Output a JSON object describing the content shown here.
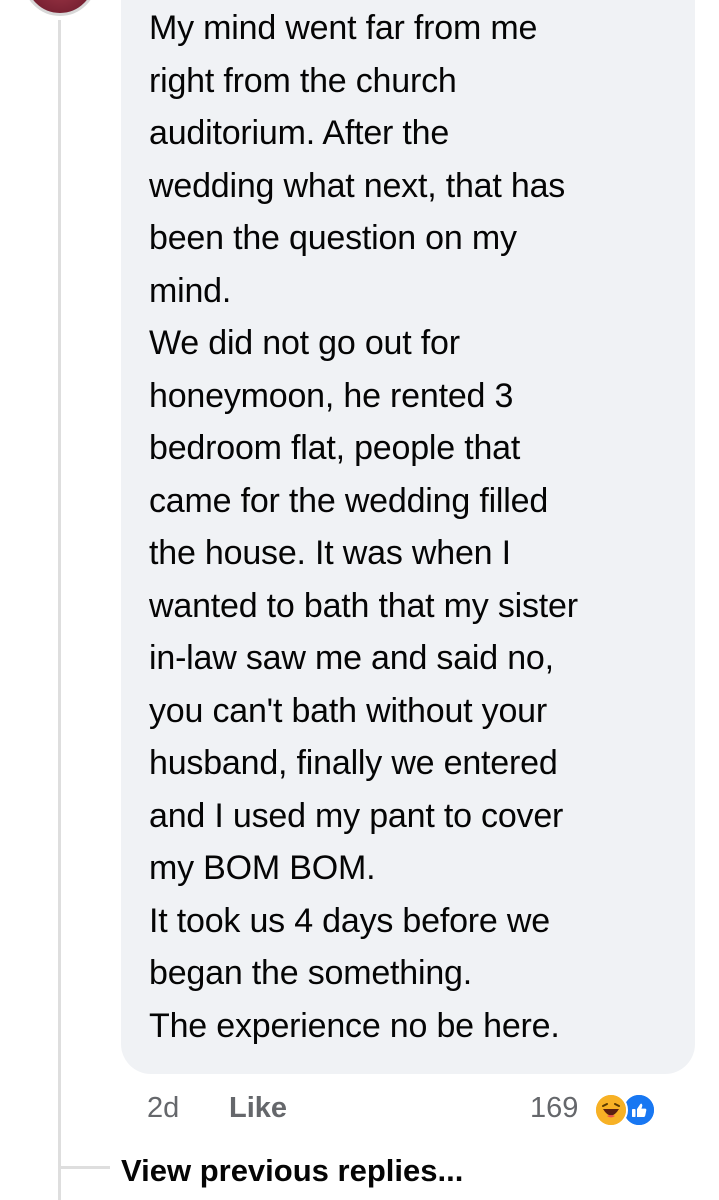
{
  "comment": {
    "text": "My mind went far from me\nright from the church\nauditorium. After the\nwedding what next, that has\nbeen the question on my\nmind.\nWe did not go out for\nhoneymoon, he rented 3\nbedroom flat, people that\ncame for the wedding filled\nthe house. It was when I\nwanted to bath that my sister\nin-law saw me and said no,\nyou can't bath without your\nhusband, finally we entered\nand I used my pant to cover\nmy BOM BOM.\nIt took us 4 days before we\nbegan the something.\nThe experience no be here.",
    "time": "2d",
    "like_label": "Like",
    "reaction_count": "169",
    "reaction_icons": [
      "haha-icon",
      "like-icon"
    ]
  },
  "replies": {
    "view_previous_label": "View previous replies..."
  },
  "colors": {
    "bubble_bg": "#f0f2f5",
    "meta_text": "#65676b",
    "primary_text": "#050505",
    "like_blue": "#1877f2",
    "haha_yellow": "#f7b125",
    "thread_line": "#dedede"
  }
}
